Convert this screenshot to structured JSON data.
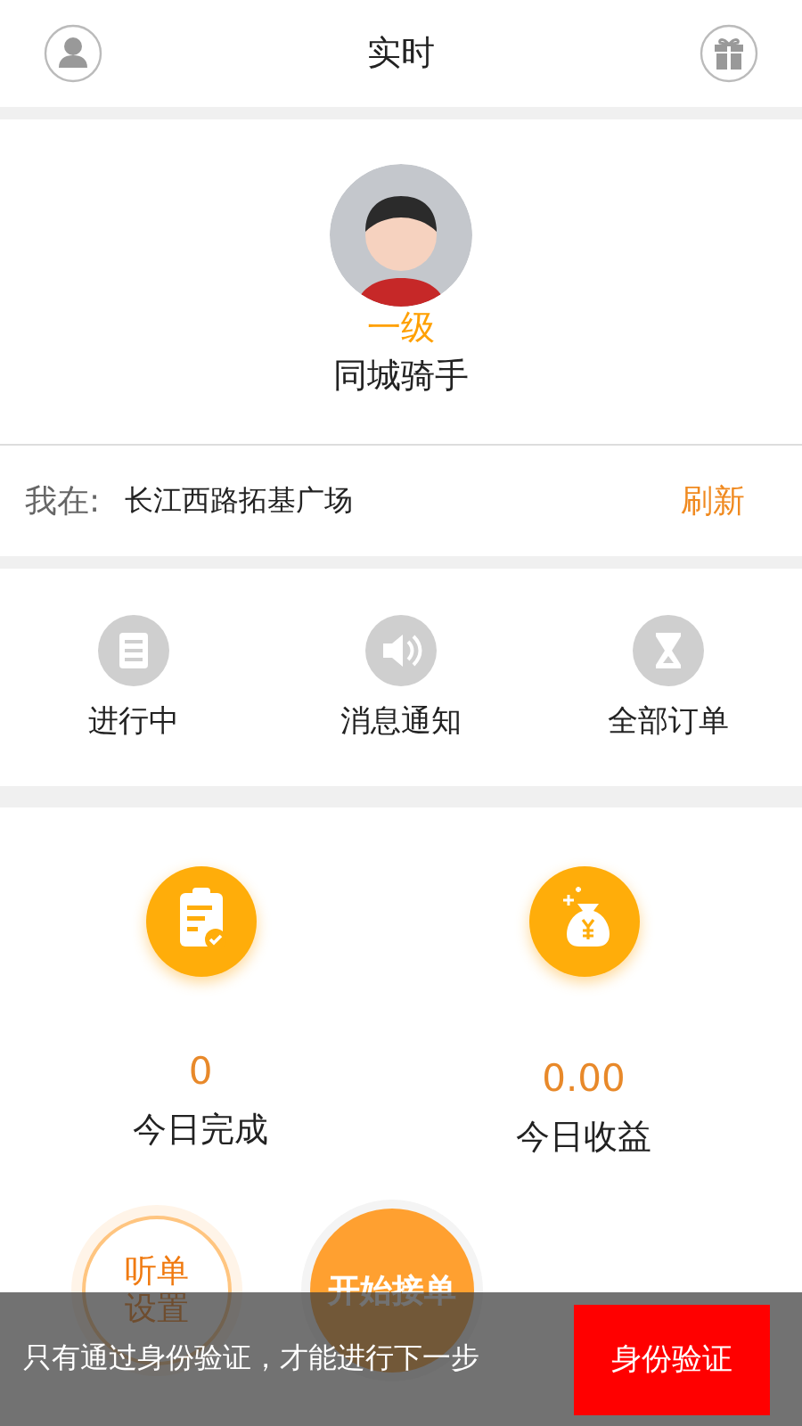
{
  "header": {
    "title": "实时"
  },
  "profile": {
    "level": "一级",
    "name": "同城骑手"
  },
  "location": {
    "label": "我在:",
    "address": "长江西路拓基广场",
    "action": "刷新"
  },
  "menu": [
    {
      "kind": "list",
      "label": "进行中"
    },
    {
      "kind": "speaker",
      "label": "消息通知"
    },
    {
      "kind": "hourglass",
      "label": "全部订单"
    }
  ],
  "stats": [
    {
      "kind": "clipboard",
      "value": "0",
      "label": "今日完成"
    },
    {
      "kind": "moneybag",
      "value": "0.00",
      "label": "今日收益"
    }
  ],
  "actions": [
    {
      "kind": "outline",
      "label": "听单设置"
    },
    {
      "kind": "filled",
      "label": "开始接单"
    }
  ],
  "snackbar": {
    "message": "只有通过身份验证，才能进行下一步",
    "action": "身份验证"
  }
}
